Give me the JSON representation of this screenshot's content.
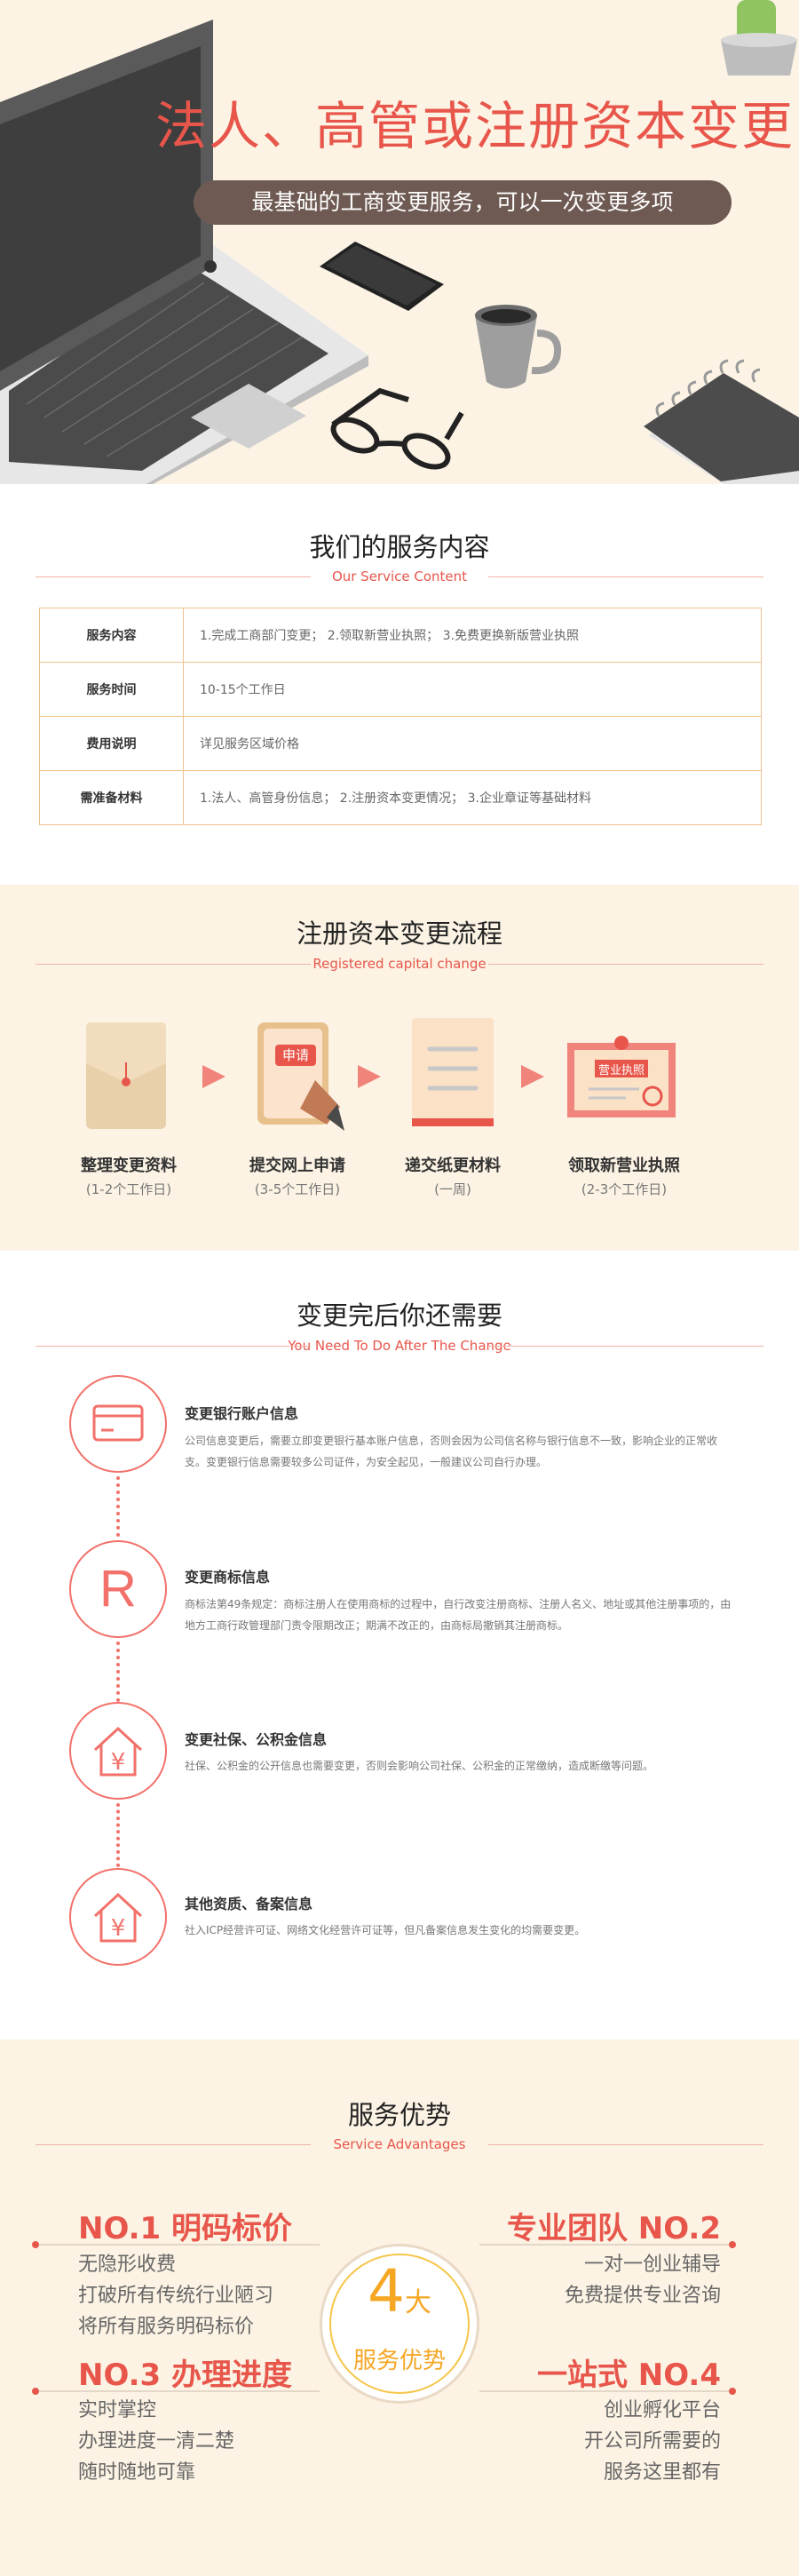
{
  "hero": {
    "title": "法人、高管或注册资本变更",
    "subtitle": "最基础的工商变更服务，可以一次变更多项"
  },
  "service": {
    "title": "我们的服务内容",
    "subtitle": "Our Service Content",
    "rows": [
      {
        "label": "服务内容",
        "value": "1.完成工商部门变更；  2.领取新营业执照；  3.免费更换新版营业执照"
      },
      {
        "label": "服务时间",
        "value": "10-15个工作日"
      },
      {
        "label": "费用说明",
        "value": "详见服务区域价格"
      },
      {
        "label": "需准备材料",
        "value": "1.法人、高管身份信息；  2.注册资本变更情况；  3.企业章证等基础材料"
      }
    ]
  },
  "process": {
    "title": "注册资本变更流程",
    "subtitle": "Registered capital change",
    "apply_tag": "申请",
    "license_tag": "营业执照",
    "steps": [
      {
        "name": "整理变更资料",
        "time": "(1-2个工作日)"
      },
      {
        "name": "提交网上申请",
        "time": "(3-5个工作日)"
      },
      {
        "name": "递交纸更材料",
        "time": "(一周)"
      },
      {
        "name": "领取新营业执照",
        "time": "(2-3个工作日)"
      }
    ]
  },
  "after": {
    "title": "变更完后你还需要",
    "subtitle": "You Need To Do After The Change",
    "items": [
      {
        "icon": "card-icon",
        "title": "变更银行账户信息",
        "desc": "公司信息变更后，需要立即变更银行基本账户信息，否则会因为公司信名称与银行信息不一致，影响企业的正常收支。变更银行信息需要较多公司证件，为安全起见，一般建议公司自行办理。"
      },
      {
        "icon": "trademark-icon",
        "title": "变更商标信息",
        "desc": "商标法第49条规定：商标注册人在使用商标的过程中，自行改变注册商标、注册人名义、地址或其他注册事项的，由地方工商行政管理部门责令限期改正；期满不改正的，由商标局撤销其注册商标。",
        "glyph": "R"
      },
      {
        "icon": "house-yen-icon",
        "title": "变更社保、公积金信息",
        "desc": "社保、公积金的公开信息也需要变更，否则会影响公司社保、公积金的正常缴纳，造成断缴等问题。",
        "glyph": "¥"
      },
      {
        "icon": "house-yen-icon",
        "title": "其他资质、备案信息",
        "desc": "社入ICP经营许可证、网络文化经营许可证等，但凡备案信息发生变化的均需要变更。",
        "glyph": "¥"
      }
    ]
  },
  "advantages": {
    "title": "服务优势",
    "subtitle": "Service Advantages",
    "center_num": "4",
    "center_big": "大",
    "center_text": "服务优势",
    "items": [
      {
        "heading": "NO.1 明码标价",
        "lines": [
          "无隐形收费",
          "打破所有传统行业陋习",
          "将所有服务明码标价"
        ]
      },
      {
        "heading": "专业团队 NO.2",
        "lines": [
          "一对一创业辅导",
          "免费提供专业咨询"
        ]
      },
      {
        "heading": "NO.3 办理进度",
        "lines": [
          "实时掌控",
          "办理进度一清二楚",
          "随时随地可靠"
        ]
      },
      {
        "heading": "一站式 NO.4",
        "lines": [
          "创业孵化平台",
          "开公司所需要的",
          "服务这里都有"
        ]
      }
    ]
  },
  "colors": {
    "accent": "#e8564b",
    "cream": "#fcf3e4",
    "brown": "#6e5a52",
    "table_border": "#f0c18c"
  }
}
